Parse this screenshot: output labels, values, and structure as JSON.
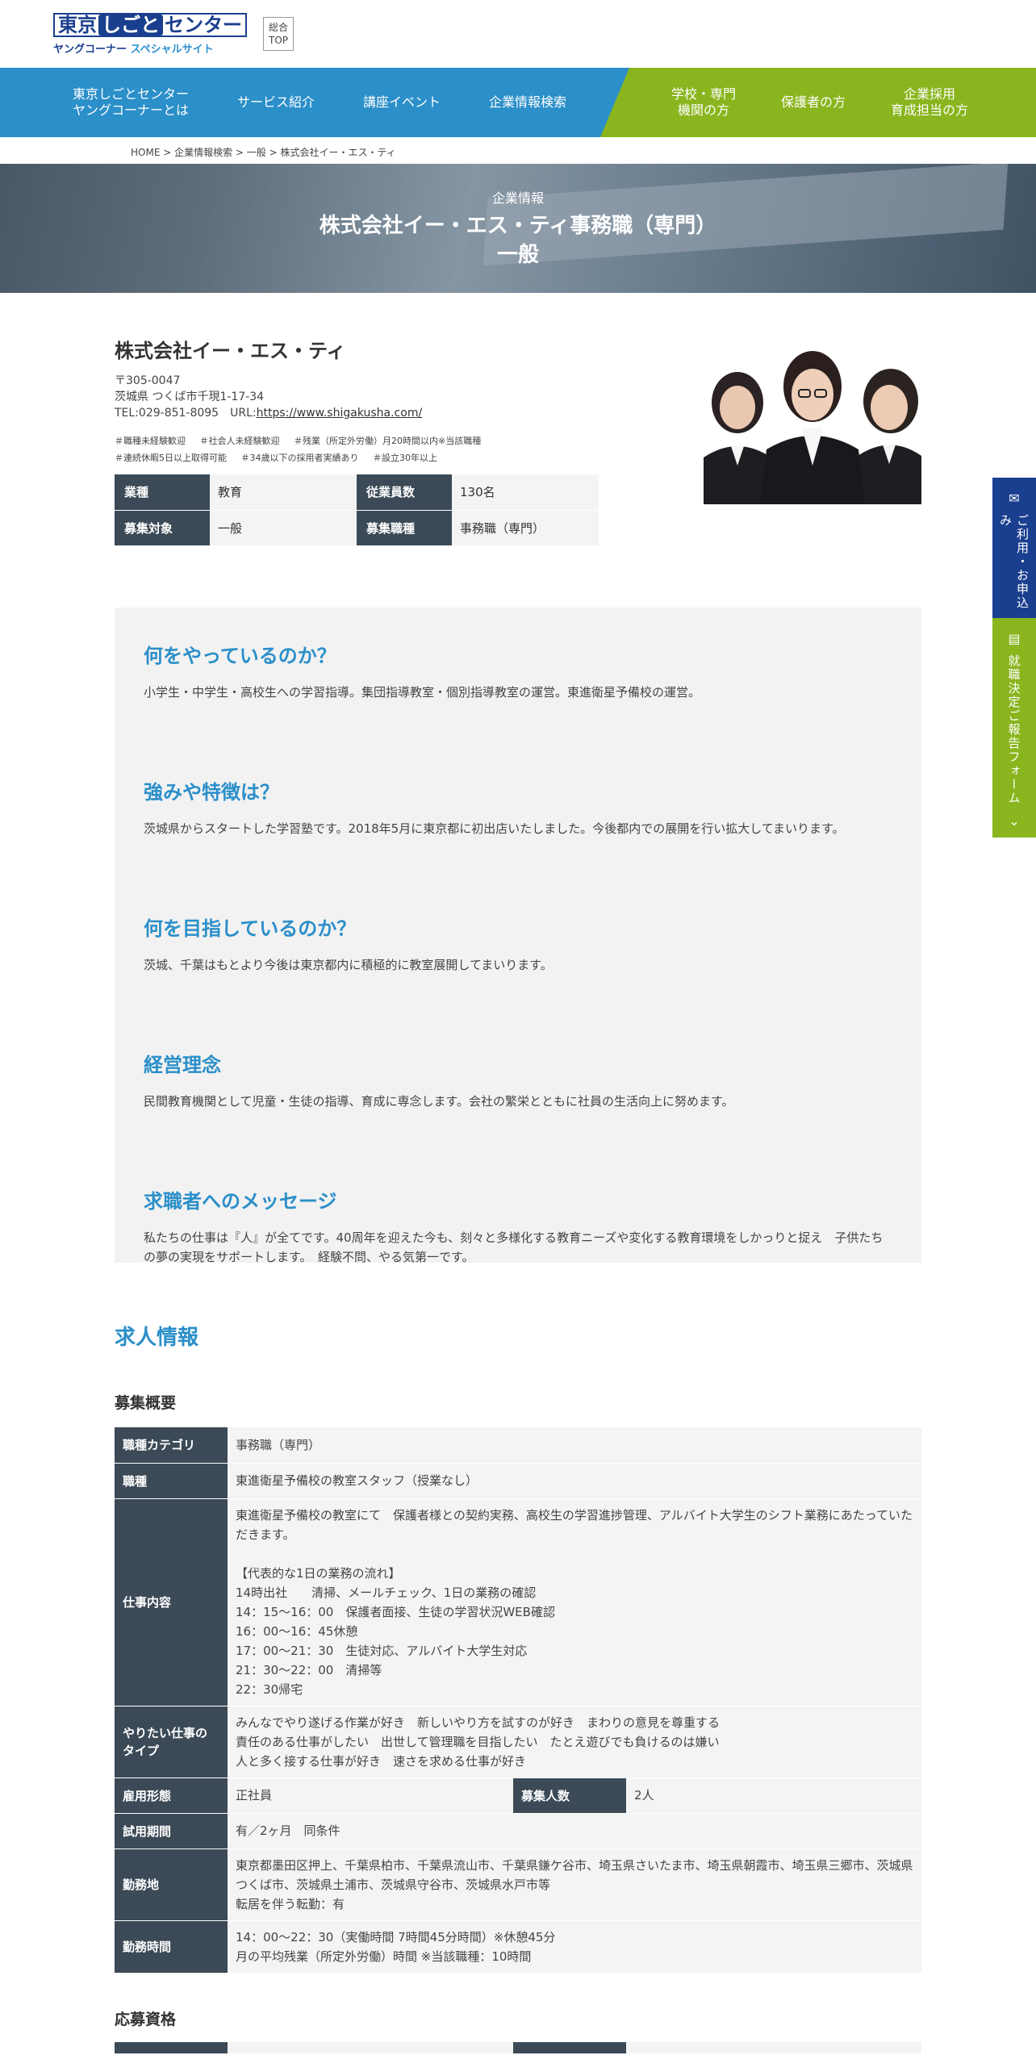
{
  "header": {
    "logo_main": [
      "東京",
      "しごと",
      "センター"
    ],
    "logo_sub_left": "ヤングコーナー",
    "logo_sub_right": "スペシャルサイト",
    "top_button": "総合\nTOP"
  },
  "nav": {
    "blue_items": [
      "東京しごとセンター\nヤングコーナーとは",
      "サービス紹介",
      "講座イベント",
      "企業情報検索"
    ],
    "green_items": [
      "学校・専門\n機関の方",
      "保護者の方",
      "企業採用\n育成担当の方"
    ]
  },
  "breadcrumb": "HOME > 企業情報検索 > 一般 > 株式会社イー・エス・ティ",
  "hero": {
    "label": "企業情報",
    "title_line1": "株式会社イー・エス・ティ事務職（専門）",
    "title_line2": "一般"
  },
  "company": {
    "name": "株式会社イー・エス・ティ",
    "postal": "〒305-0047",
    "address": "茨城県 つくば市千現1-17-34",
    "tel_prefix": "TEL:029-851-8095　URL:",
    "url": "https://www.shigakusha.com/",
    "tags": [
      "＃職種未経験歓迎",
      "＃社会人未経験歓迎",
      "＃残業（所定外労働）月20時間以内※当該職種",
      "＃連続休暇5日以上取得可能",
      "＃34歳以下の採用者実績あり",
      "＃設立30年以上"
    ],
    "table": {
      "industry_label": "業種",
      "industry": "教育",
      "employees_label": "従業員数",
      "employees": "130名",
      "target_label": "募集対象",
      "target": "一般",
      "job_label": "募集職種",
      "job": "事務職（専門）"
    }
  },
  "features": [
    {
      "title": "何をやっているのか？",
      "body": "小学生・中学生・高校生への学習指導。集団指導教室・個別指導教室の運営。東進衛星予備校の運営。"
    },
    {
      "title": "強みや特徴は？",
      "body": "茨城県からスタートした学習塾です。2018年5月に東京都に初出店いたしました。今後都内での展開を行い拡大してまいります。"
    },
    {
      "title": "何を目指しているのか？",
      "body": "茨城、千葉はもとより今後は東京都内に積極的に教室展開してまいります。"
    },
    {
      "title": "経営理念",
      "body": "民間教育機関として児童・生徒の指導、育成に専念します。会社の繁栄とともに社員の生活向上に努めます。"
    },
    {
      "title": "求職者へのメッセージ",
      "body": "私たちの仕事は『人』が全てです。40周年を迎えた今も、刻々と多様化する教育ニーズや変化する教育環境をしかっりと捉え　子供たちの夢の実現をサポートします。　経験不問、やる気第一です。"
    }
  ],
  "jobs": {
    "heading": "求人情報",
    "overview_heading": "募集概要",
    "rows": {
      "category_label": "職種カテゴリ",
      "category": "事務職（専門）",
      "job_label": "職種",
      "job": "東進衛星予備校の教室スタッフ（授業なし）",
      "duties_label": "仕事内容",
      "duties": "東進衛星予備校の教室にて　保護者様との契約実務、高校生の学習進捗管理、アルバイト大学生のシフト業務にあたっていただきます。\n\n【代表的な1日の業務の流れ】\n14時出社　　清掃、メールチェック、1日の業務の確認\n14：15～16：00　保護者面接、生徒の学習状況WEB確認\n16：00～16：45休憩\n17：00～21：30　生徒対応、アルバイト大学生対応\n21：30～22：00　清掃等\n22：30帰宅",
      "type_label": "やりたい仕事の\nタイプ",
      "type": "みんなでやり遂げる作業が好き　新しいやり方を試すのが好き　まわりの意見を尊重する\n責任のある仕事がしたい　出世して管理職を目指したい　たとえ遊びでも負けるのは嫌い\n人と多く接する仕事が好き　速さを求める仕事が好き",
      "employment_label": "雇用形態",
      "employment": "正社員",
      "openings_label": "募集人数",
      "openings": "2人",
      "trial_label": "試用期間",
      "trial": "有／2ヶ月　同条件",
      "location_label": "勤務地",
      "location": "東京都墨田区押上、千葉県柏市、千葉県流山市、千葉県鎌ケ谷市、埼玉県さいたま市、埼玉県朝霞市、埼玉県三郷市、茨城県つくば市、茨城県土浦市、茨城県守谷市、茨城県水戸市等\n転居を伴う転勤：有",
      "hours_label": "勤務時間",
      "hours": "14：00～22：30（実働時間 7時間45分時間）※休憩45分\n月の平均残業（所定外労働）時間 ※当該職種：10時間"
    },
    "qualification_heading": "応募資格"
  },
  "side_tabs": {
    "apply": "ご利用・お申込み",
    "report": "就職決定ご報告フォーム"
  }
}
